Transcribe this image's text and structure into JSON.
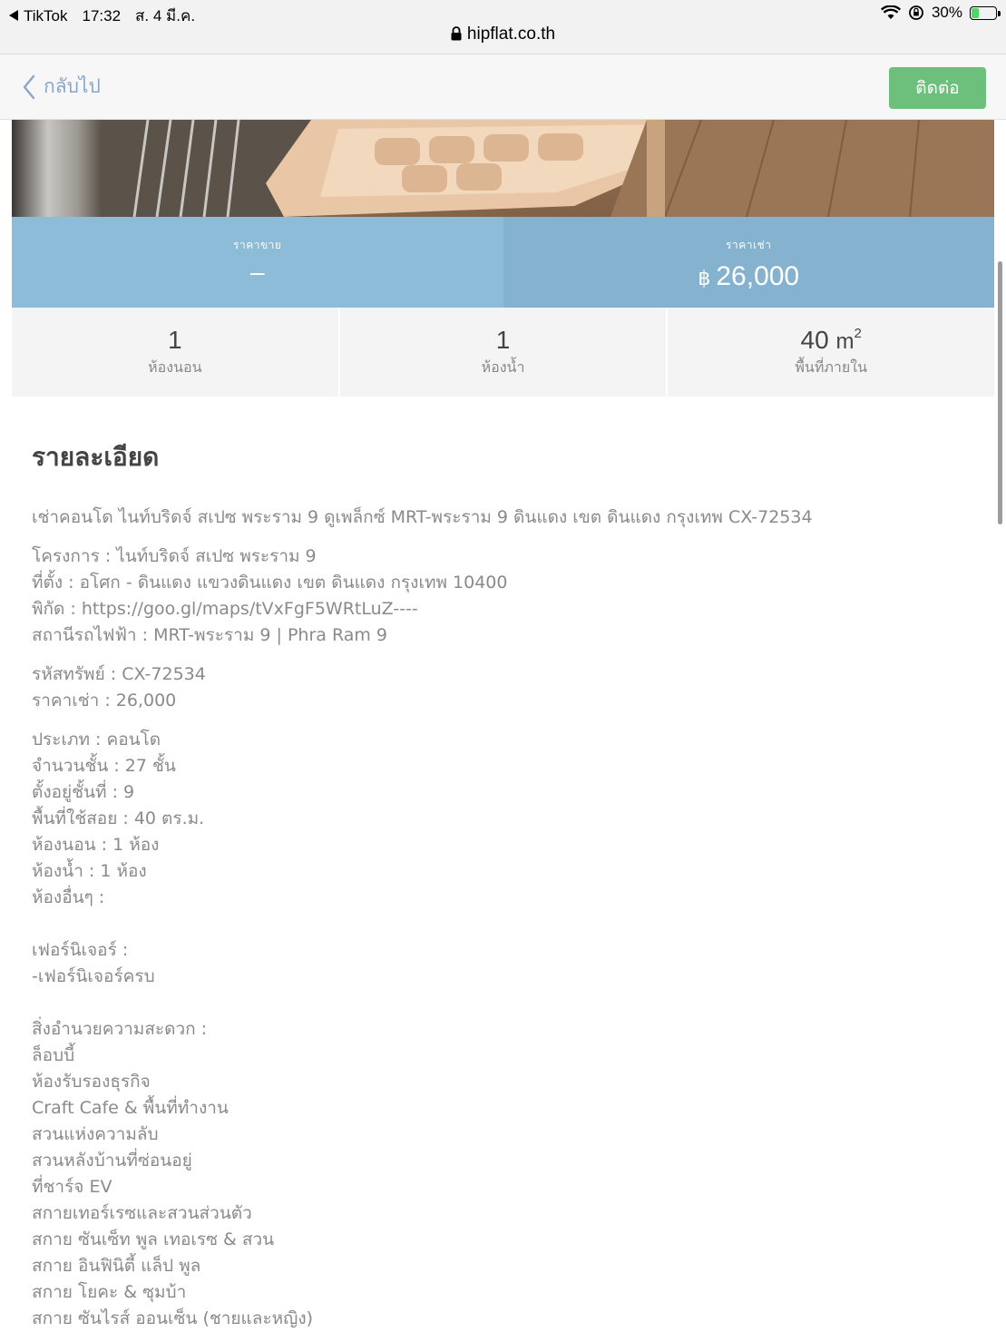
{
  "statusbar": {
    "back_app": "TikTok",
    "time": "17:32",
    "date": "ส. 4 มี.ค.",
    "battery": "30%",
    "battery_level": 0.3,
    "url": "hipflat.co.th"
  },
  "nav": {
    "back_label": "กลับไป",
    "contact_label": "ติดต่อ"
  },
  "prices": {
    "sale_label": "ราคาขาย",
    "sale_value": "–",
    "rent_label": "ราคาเช่า",
    "currency": "฿",
    "rent_value": "26,000"
  },
  "stats": {
    "bedrooms_value": "1",
    "bedrooms_label": "ห้องนอน",
    "bathrooms_value": "1",
    "bathrooms_label": "ห้องน้ำ",
    "area_value": "40",
    "area_unit": "m",
    "area_unit_sup": "2",
    "area_label": "พื้นที่ภายใน"
  },
  "details": {
    "heading": "รายละเอียด",
    "summary": "เช่าคอนโด ไนท์บริดจ์ สเปซ พระราม 9 ดูเพล็กซ์ MRT-พระราม 9 ดินแดง เขต ดินแดง กรุงเทพ CX-72534",
    "location": [
      "โครงการ : ไนท์บริดจ์ สเปซ พระราม 9",
      "ที่ตั้ง : อโศก - ดินแดง แขวงดินแดง เขต ดินแดง กรุงเทพ 10400",
      "พิกัด : https://goo.gl/maps/tVxFgF5WRtLuZ----",
      "สถานีรถไฟฟ้า : MRT-พระราม 9 | Phra Ram 9"
    ],
    "code": [
      "รหัสทรัพย์ : CX-72534",
      "ราคาเช่า : 26,000"
    ],
    "specs": [
      "ประเภท : คอนโด",
      "จำนวนชั้น : 27 ชั้น",
      "ตั้งอยู่ชั้นที่ : 9",
      "พื้นที่ใช้สอย : 40 ตร.ม.",
      "ห้องนอน : 1 ห้อง",
      "ห้องน้ำ : 1 ห้อง",
      "ห้องอื่นๆ :"
    ],
    "furniture": [
      "เฟอร์นิเจอร์ :",
      "-เฟอร์นิเจอร์ครบ"
    ],
    "facilities": [
      "สิ่งอำนวยความสะดวก :",
      "ล็อบบี้",
      "ห้องรับรองธุรกิจ",
      "Craft Cafe & พื้นที่ทำงาน",
      "สวนแห่งความลับ",
      "สวนหลังบ้านที่ซ่อนอยู่",
      "ที่ชาร์จ EV",
      "สกายเทอร์เรซและสวนส่วนตัว",
      "สกาย ซันเซ็ท พูล เทอเรซ & สวน",
      "สกาย อินฟินิตี้ แล็ป พูล",
      "สกาย โยคะ & ซุมบ้า",
      "สกาย ซันไรส์ ออนเซ็น (ชายและหญิง)"
    ]
  }
}
